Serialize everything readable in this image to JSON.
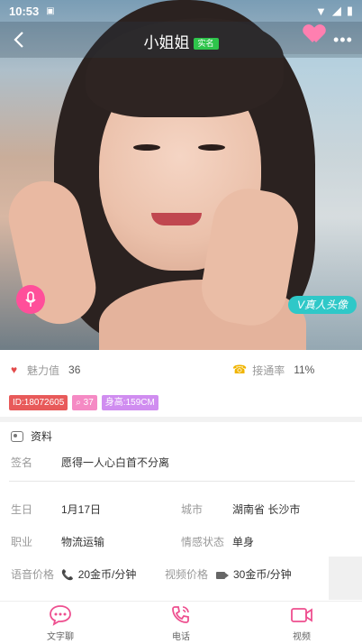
{
  "status_bar": {
    "time": "10:53"
  },
  "header": {
    "title": "小姐姐",
    "verify_badge": "实名"
  },
  "hero": {
    "real_badge": "V真人头像"
  },
  "stats": {
    "charm_label": "魅力值",
    "charm_value": "36",
    "connect_label": "接通率",
    "connect_value": "11%"
  },
  "tags": {
    "id": "ID:18072605",
    "count": "37",
    "height": "身高:159CM"
  },
  "profile": {
    "section_title": "资料",
    "signature_label": "签名",
    "signature_value": "愿得一人心白首不分离",
    "birthday_label": "生日",
    "birthday_value": "1月17日",
    "city_label": "城市",
    "city_value": "湖南省 长沙市",
    "job_label": "职业",
    "job_value": "物流运输",
    "status_label": "情感状态",
    "status_value": "单身",
    "voice_price_label": "语音价格",
    "voice_price_value": "20金币/分钟",
    "video_price_label": "视频价格",
    "video_price_value": "30金币/分钟"
  },
  "bottom_nav": [
    {
      "label": "文字聊"
    },
    {
      "label": "电话"
    },
    {
      "label": "视频"
    }
  ],
  "colors": {
    "accent_pink": "#ff4f9a",
    "nav_pink": "#ee4f8f",
    "tag_red": "#e85a5a",
    "tag_pink": "#f58ac4",
    "tag_purple": "#d08df0",
    "badge_teal": "#2fc8c8"
  }
}
